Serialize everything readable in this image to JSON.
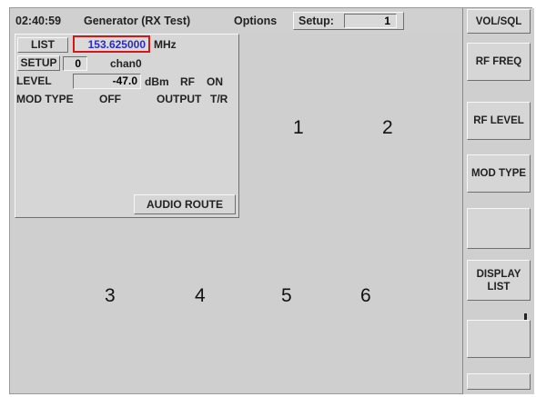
{
  "topbar": {
    "time": "02:40:59",
    "title": "Generator (RX Test)",
    "options_label": "Options",
    "setup_label": "Setup:",
    "setup_value": "1"
  },
  "panel": {
    "list_label": "LIST",
    "frequency_value": "153.625000",
    "frequency_unit": "MHz",
    "setup_label": "SETUP",
    "setup_value": "0",
    "setup_name": "chan0",
    "level_label": "LEVEL",
    "level_value": "-47.0",
    "level_unit": "dBm",
    "rf_label": "RF",
    "rf_state": "ON",
    "mod_type_label": "MOD TYPE",
    "mod_type_value": "OFF",
    "output_label": "OUTPUT",
    "output_value": "T/R",
    "audio_route_label": "AUDIO ROUTE"
  },
  "callouts": [
    "1",
    "2",
    "3",
    "4",
    "5",
    "6"
  ],
  "softkeys": {
    "vol_sql": "VOL/SQL",
    "rf_freq": "RF FREQ",
    "rf_level": "RF LEVEL",
    "mod_type": "MOD TYPE",
    "blank1": "",
    "display_list_line1": "DISPLAY",
    "display_list_line2": "LIST",
    "blank2": "",
    "blank3": ""
  },
  "colors": {
    "frequency_text": "#2b2bc0",
    "frequency_border": "#d01818",
    "screen_background": "#cfcfcf"
  }
}
